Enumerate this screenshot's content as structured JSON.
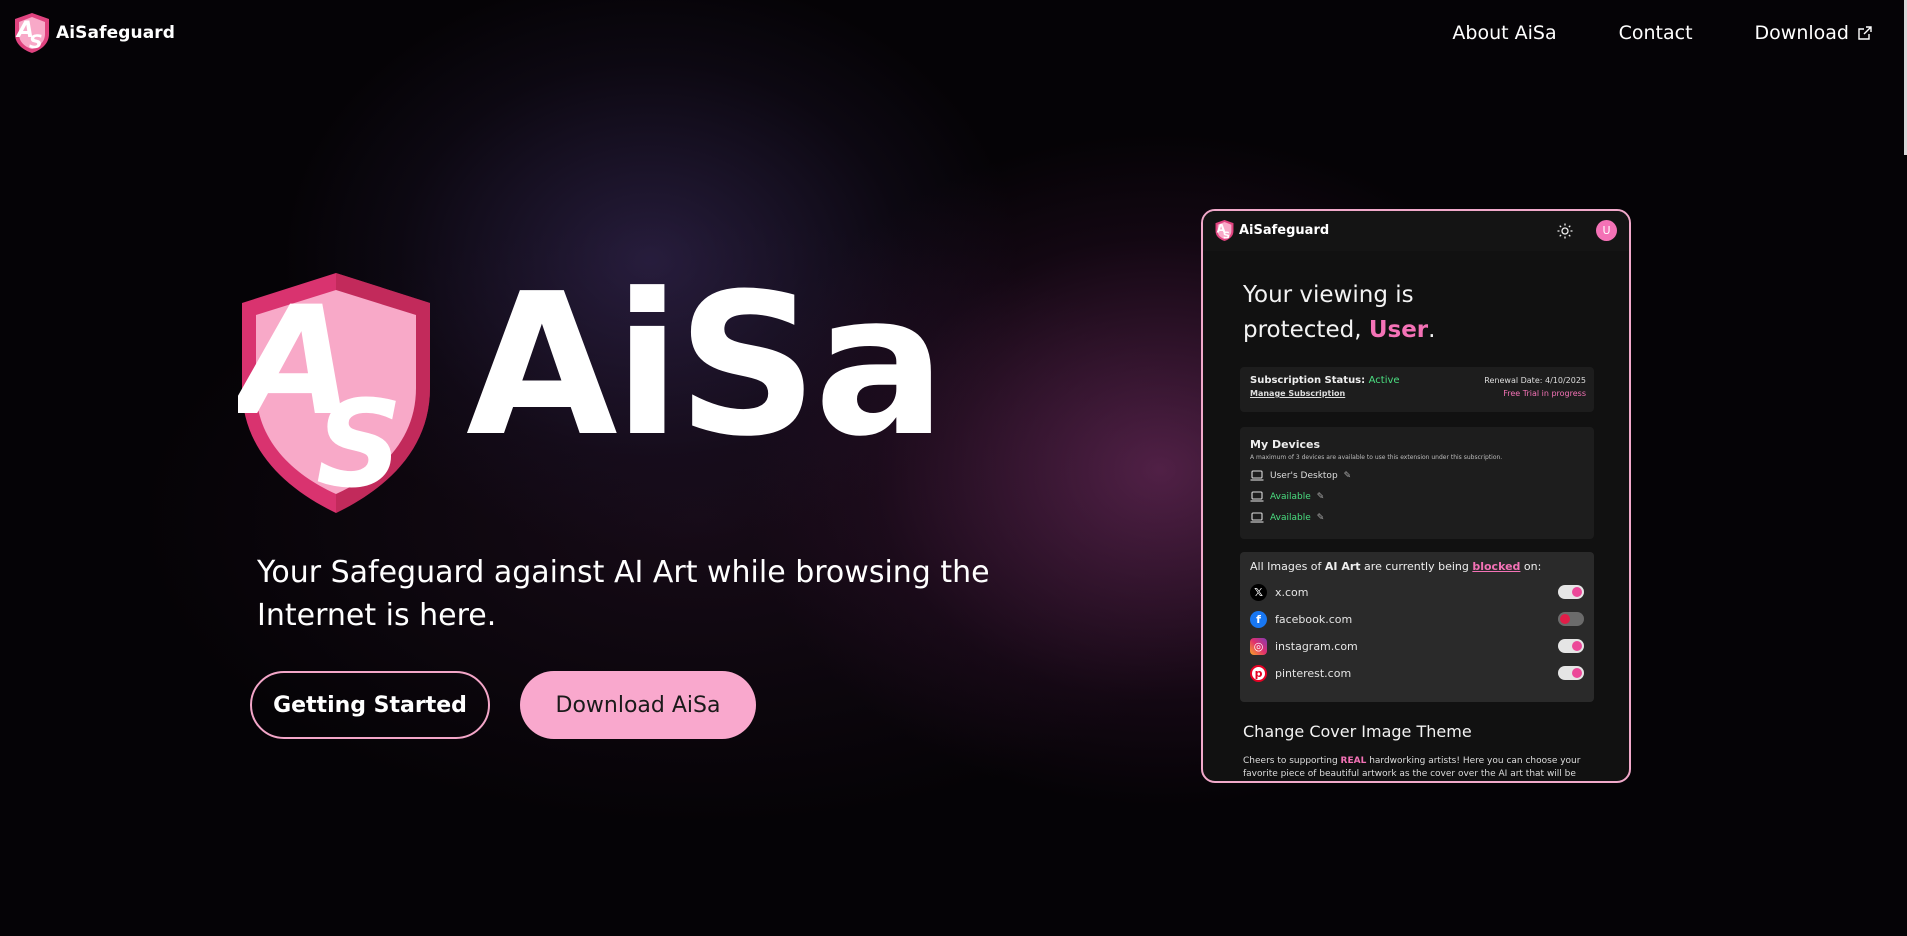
{
  "nav": {
    "brand": "AiSafeguard",
    "links": [
      {
        "label": "About AiSa"
      },
      {
        "label": "Contact"
      },
      {
        "label": "Download"
      }
    ]
  },
  "hero": {
    "logo_letters": "AS",
    "title": "AiSa",
    "tagline": "Your Safeguard against AI Art while browsing the Internet is here.",
    "primary_button": "Getting Started",
    "secondary_button": "Download AiSa"
  },
  "preview": {
    "brand": "AiSafeguard",
    "avatar_initial": "U",
    "heading_line1": "Your viewing is",
    "heading_prefix": "protected, ",
    "heading_user": "User",
    "heading_suffix": ".",
    "subscription": {
      "label": "Subscription Status:",
      "status": "Active",
      "manage": "Manage Subscription",
      "renewal": "Renewal Date: 4/10/2025",
      "trial": "Free Trial in progress"
    },
    "devices": {
      "title": "My Devices",
      "note": "A maximum of 3 devices are available to use this extension under this subscription.",
      "items": [
        "User's Desktop",
        "Available",
        "Available"
      ]
    },
    "sites": {
      "heading_start": "All Images of ",
      "heading_bold": "AI Art",
      "heading_mid": " are currently being ",
      "heading_blocked": "blocked",
      "heading_end": " on:",
      "items": [
        {
          "label": "x.com",
          "enabled": true
        },
        {
          "label": "facebook.com",
          "enabled": false
        },
        {
          "label": "instagram.com",
          "enabled": true
        },
        {
          "label": "pinterest.com",
          "enabled": true
        }
      ]
    },
    "theme": {
      "title": "Change Cover Image Theme",
      "desc_start": "Cheers to supporting ",
      "desc_real": "REAL",
      "desc_end": " hardworking artists! Here you can choose your favorite piece of beautiful artwork as the cover over the AI art that will be hidden."
    }
  },
  "colors": {
    "accent_pink": "#f472b6",
    "button_pink": "#f9a8cd",
    "active_green": "#4ade80"
  }
}
